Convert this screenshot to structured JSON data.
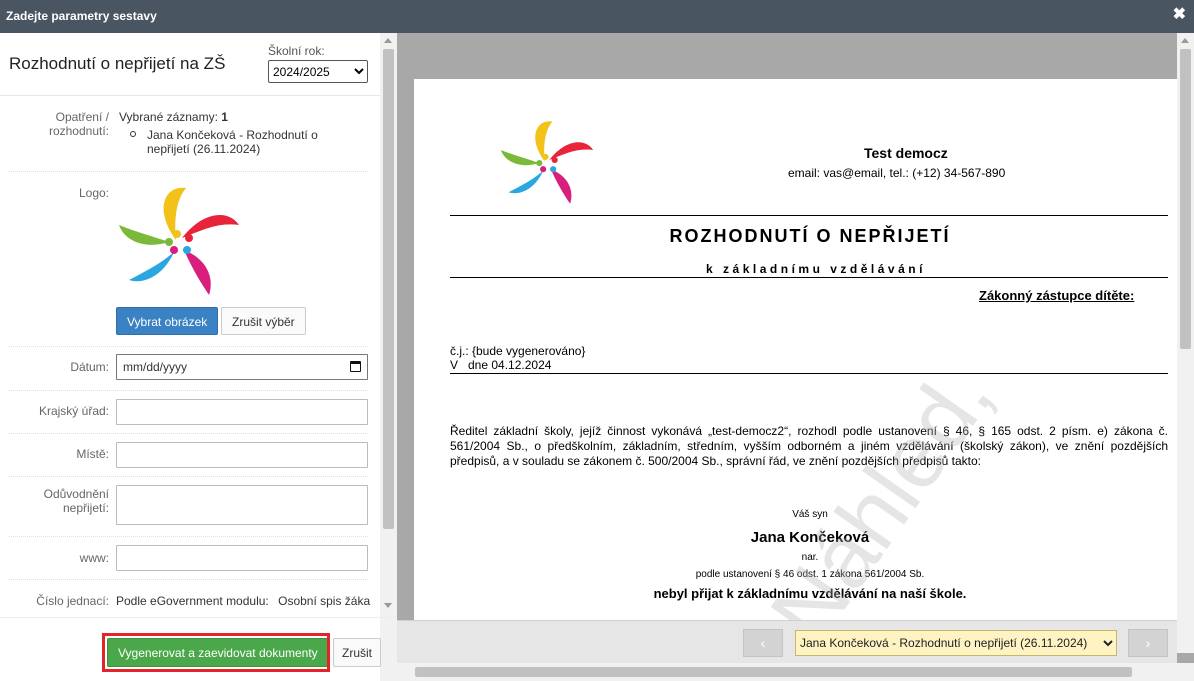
{
  "window": {
    "title": "Zadejte parametry sestavy",
    "close_glyph": "✖"
  },
  "left": {
    "heading": "Rozhodnutí o nepřijetí na ZŠ",
    "year_label": "Školní rok:",
    "year_value": "2024/2025",
    "fields": {
      "opatreni_label": "Opatření / rozhodnutí:",
      "selected_prefix": "Vybrané záznamy: ",
      "selected_count": "1",
      "selected_item": "Jana Končeková - Rozhodnutí o nepřijetí (26.11.2024)",
      "logo_label": "Logo:",
      "choose_image": "Vybrat obrázek",
      "cancel_choice": "Zrušit výběr",
      "date_label": "Dátum:",
      "date_placeholder": "mm/dd/yyyy",
      "krajsky_label": "Krajský úřad:",
      "miste_label": "Místě:",
      "oduvodneni_label": "Odůvodnění nepřijetí:",
      "www_label": "www:",
      "cislo_label": "Číslo jednací:",
      "cislo_value": "Podle eGovernment modulu:",
      "cislo_value2": "Osobní spis žáka"
    },
    "footer": {
      "generate": "Vygenerovat a zaevidovat dokumenty",
      "cancel": "Zrušit"
    }
  },
  "preview": {
    "org_name": "Test democz",
    "contact": "email: vas@email, tel.: (+12) 34-567-890",
    "doc_title": "ROZHODNUTÍ O NEPŘIJETÍ",
    "doc_subtitle": "k základnímu vzdělávání",
    "guardian": "Zákonný zástupce dítěte:",
    "cj": "č.j.: {bude vygenerováno}",
    "place_date": "V   dne 04.12.2024",
    "body": "Ředitel základní školy, jejíž činnost vykonává  „test-democz2“, rozhodl podle ustanovení § 46, § 165 odst. 2 písm. e) zákona č. 561/2004 Sb., o předškolním, základním, středním, vyšším odborném a jiném vzdělávání (školský zákon), ve znění pozdějších předpisů, a v souladu se zákonem č. 500/2004 Sb., správní řád, ve znění pozdějších předpisů takto:",
    "vas_syn": "Váš syn",
    "student": "Jana Končeková",
    "nar": "nar.",
    "per_law": "podle ustanovení § 46 odst. 1 zákona 561/2004 Sb.",
    "verdict": "nebyl přijat k základnímu vzdělávání na naší škole.",
    "watermark": "Náhled,",
    "nav_select": "Jana Končeková - Rozhodnutí o nepřijetí (26.11.2024)",
    "prev_glyph": "‹",
    "next_glyph": "›"
  },
  "colors": {
    "titlebar": "#4a5562",
    "primary": "#3b82c4",
    "success": "#4aa84a",
    "highlight": "#e3252b"
  },
  "icons": {
    "logo": "pinwheel-logo-icon",
    "calendar": "calendar-icon",
    "close": "close-icon"
  }
}
